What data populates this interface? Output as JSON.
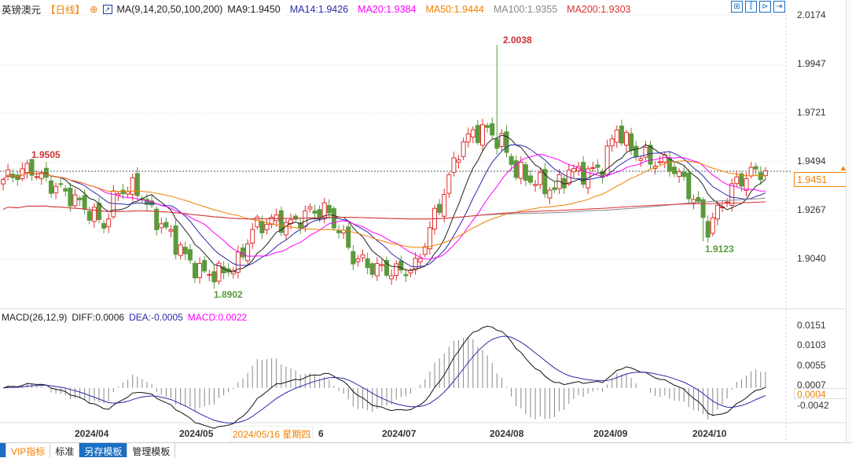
{
  "header": {
    "instrument": "英镑澳元",
    "period": "【日线】",
    "ma_label": "MA(9,14,20,50,100,200)",
    "ma": [
      {
        "label": "MA9:1.9450",
        "color": "#222222",
        "n": 9
      },
      {
        "label": "MA14:1.9426",
        "color": "#2a2aa8",
        "n": 14
      },
      {
        "label": "MA20:1.9384",
        "color": "#ff00ff",
        "n": 20
      },
      {
        "label": "MA50:1.9444",
        "color": "#f08000",
        "n": 50
      },
      {
        "label": "MA100:1.9355",
        "color": "#888888",
        "n": 100
      },
      {
        "label": "MA200:1.9303",
        "color": "#e03030",
        "n": 200
      }
    ],
    "tools": [
      "⊞",
      "⫿",
      "⊳",
      "⇥"
    ]
  },
  "price_axis": {
    "ticks": [
      "2.0174",
      "1.9947",
      "1.9721",
      "1.9494",
      "1.9267",
      "1.9040"
    ],
    "max": 2.0174,
    "min": 1.8813,
    "last_price": "1.9451"
  },
  "annotations": {
    "high1": "1.9505",
    "high2": "2.0038",
    "low1": "1.8902",
    "low2": "1.9123"
  },
  "macd": {
    "label": "MACD(26,12,9)",
    "diff": "DIFF:0.0006",
    "dea": "DEA:-0.0005",
    "macd": "MACD:0.0022",
    "ticks": [
      "0.0151",
      "0.0103",
      "0.0055",
      "0.0007",
      "-0.0042"
    ],
    "current": "0.0004"
  },
  "dates": {
    "labels": [
      "2024/04",
      "2024/05",
      "2024/07",
      "2024/08",
      "2024/09",
      "2024/10"
    ],
    "cursor": "2024/05/16 星期四",
    "partial": "6"
  },
  "bottom_tabs": [
    "VIP指标",
    "标准",
    "另存模板",
    "管理模板"
  ],
  "colors": {
    "up": "#e03030",
    "down": "#5a9a3c",
    "accent": "#f08000"
  },
  "chart_data": {
    "type": "candlestick",
    "count": 160,
    "close_keypoints": [
      [
        0,
        1.941
      ],
      [
        3,
        1.944
      ],
      [
        6,
        1.946
      ],
      [
        9,
        1.94
      ],
      [
        13,
        1.935
      ],
      [
        17,
        1.928
      ],
      [
        21,
        1.92
      ],
      [
        24,
        1.936
      ],
      [
        28,
        1.937
      ],
      [
        31,
        1.925
      ],
      [
        35,
        1.915
      ],
      [
        38,
        1.905
      ],
      [
        41,
        1.898
      ],
      [
        45,
        1.897
      ],
      [
        49,
        1.902
      ],
      [
        52,
        1.918
      ],
      [
        56,
        1.922
      ],
      [
        60,
        1.92
      ],
      [
        64,
        1.926
      ],
      [
        67,
        1.927
      ],
      [
        70,
        1.918
      ],
      [
        73,
        1.905
      ],
      [
        77,
        1.9
      ],
      [
        82,
        1.898
      ],
      [
        86,
        1.9
      ],
      [
        89,
        1.918
      ],
      [
        92,
        1.935
      ],
      [
        95,
        1.955
      ],
      [
        98,
        1.963
      ],
      [
        101,
        1.964
      ],
      [
        104,
        1.958
      ],
      [
        107,
        1.945
      ],
      [
        111,
        1.94
      ],
      [
        115,
        1.936
      ],
      [
        118,
        1.945
      ],
      [
        122,
        1.944
      ],
      [
        125,
        1.947
      ],
      [
        128,
        1.965
      ],
      [
        131,
        1.955
      ],
      [
        135,
        1.95
      ],
      [
        139,
        1.948
      ],
      [
        142,
        1.94
      ],
      [
        145,
        1.928
      ],
      [
        147,
        1.918
      ],
      [
        150,
        1.93
      ],
      [
        153,
        1.94
      ],
      [
        157,
        1.945
      ],
      [
        159,
        1.9451
      ]
    ],
    "extremes": [
      [
        6,
        1.9505
      ],
      [
        103,
        2.0038
      ],
      [
        44,
        1.8902
      ],
      [
        146,
        1.9123
      ]
    ]
  }
}
